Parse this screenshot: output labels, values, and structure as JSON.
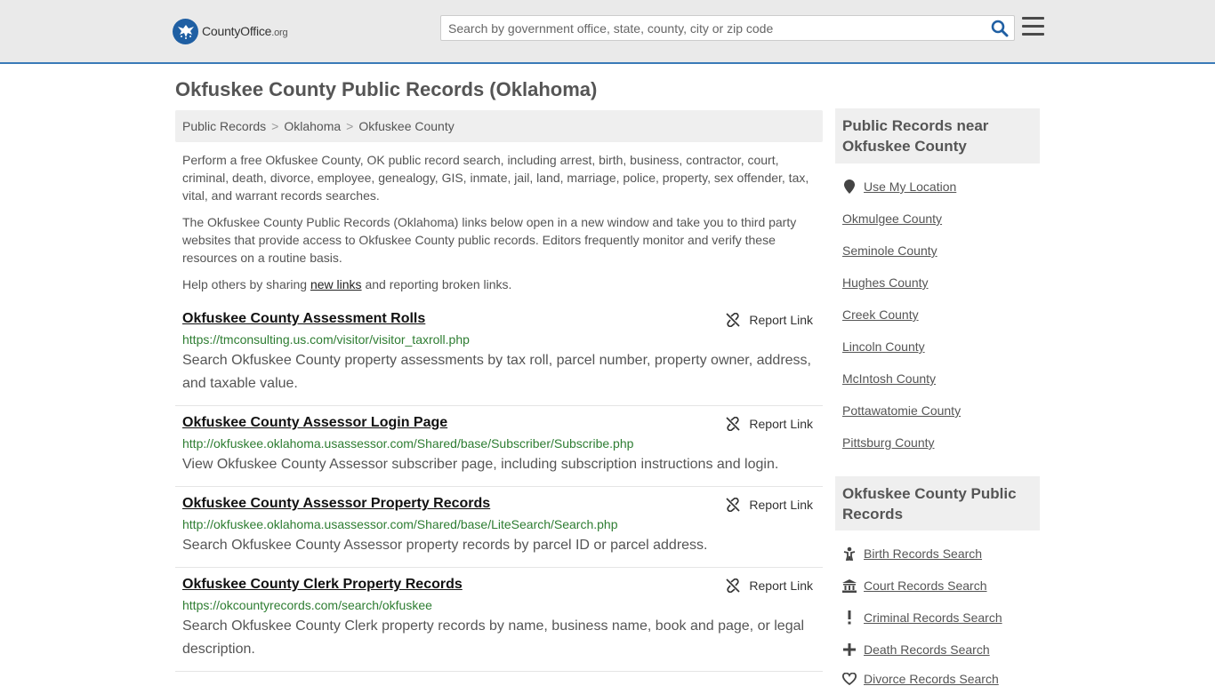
{
  "header": {
    "logo_main": "CountyOffice",
    "logo_suffix": ".org",
    "search_placeholder": "Search by government office, state, county, city or zip code"
  },
  "page_title": "Okfuskee County Public Records (Oklahoma)",
  "breadcrumb": [
    "Public Records",
    "Oklahoma",
    "Okfuskee County"
  ],
  "intro": {
    "p1": "Perform a free Okfuskee County, OK public record search, including arrest, birth, business, contractor, court, criminal, death, divorce, employee, genealogy, GIS, inmate, jail, land, marriage, police, property, sex offender, tax, vital, and warrant records searches.",
    "p2": "The Okfuskee County Public Records (Oklahoma) links below open in a new window and take you to third party websites that provide access to Okfuskee County public records. Editors frequently monitor and verify these resources on a routine basis.",
    "p3_before": "Help others by sharing ",
    "p3_link": "new links",
    "p3_after": " and reporting broken links."
  },
  "report_label": "Report Link",
  "results": [
    {
      "title": "Okfuskee County Assessment Rolls",
      "url": "https://tmconsulting.us.com/visitor/visitor_taxroll.php",
      "desc": "Search Okfuskee County property assessments by tax roll, parcel number, property owner, address, and taxable value."
    },
    {
      "title": "Okfuskee County Assessor Login Page",
      "url": "http://okfuskee.oklahoma.usassessor.com/Shared/base/Subscriber/Subscribe.php",
      "desc": "View Okfuskee County Assessor subscriber page, including subscription instructions and login."
    },
    {
      "title": "Okfuskee County Assessor Property Records",
      "url": "http://okfuskee.oklahoma.usassessor.com/Shared/base/LiteSearch/Search.php",
      "desc": "Search Okfuskee County Assessor property records by parcel ID or parcel address."
    },
    {
      "title": "Okfuskee County Clerk Property Records",
      "url": "https://okcountyrecords.com/search/okfuskee",
      "desc": "Search Okfuskee County Clerk property records by name, business name, book and page, or legal description."
    }
  ],
  "sidebar": {
    "nearby_title": "Public Records near Okfuskee County",
    "use_location": "Use My Location",
    "nearby": [
      "Okmulgee County",
      "Seminole County",
      "Hughes County",
      "Creek County",
      "Lincoln County",
      "McIntosh County",
      "Pottawatomie County",
      "Pittsburg County"
    ],
    "records_title": "Okfuskee County Public Records",
    "records": [
      {
        "label": "Birth Records Search",
        "icon": "child-icon"
      },
      {
        "label": "Court Records Search",
        "icon": "courthouse-icon"
      },
      {
        "label": "Criminal Records Search",
        "icon": "exclamation-icon"
      },
      {
        "label": "Death Records Search",
        "icon": "cross-icon"
      },
      {
        "label": "Divorce Records Search",
        "icon": "broken-heart-icon"
      }
    ]
  }
}
